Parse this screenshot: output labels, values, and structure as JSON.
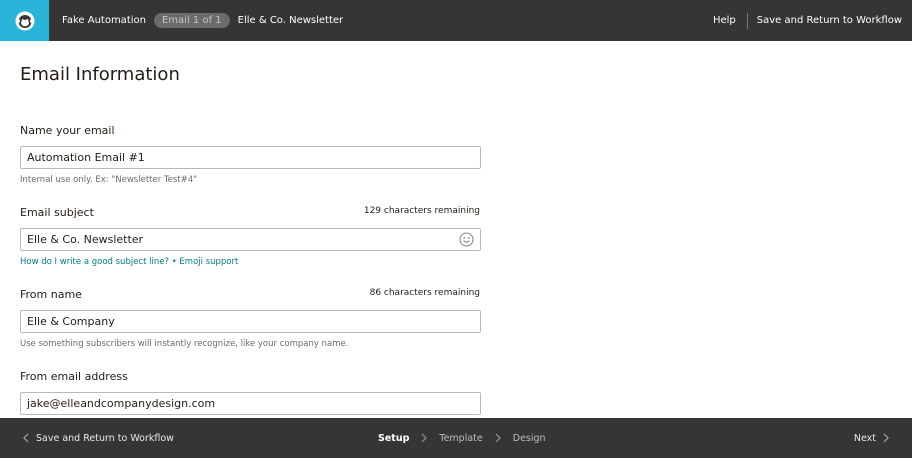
{
  "header": {
    "breadcrumb": {
      "automation": "Fake Automation",
      "email_badge": "Email 1 of 1",
      "email_name": "Elle & Co. Newsletter"
    },
    "help": "Help",
    "save_return": "Save and Return to Workflow"
  },
  "main": {
    "title": "Email Information",
    "name": {
      "label": "Name your email",
      "value": "Automation Email #1",
      "hint": "Internal use only. Ex: \"Newsletter Test#4\""
    },
    "subject": {
      "label": "Email subject",
      "remaining": "129 characters remaining",
      "value": "Elle & Co. Newsletter",
      "help_link": "How do I write a good subject line?",
      "separator": " • ",
      "emoji_link": "Emoji support"
    },
    "from_name": {
      "label": "From name",
      "remaining": "86 characters remaining",
      "value": "Elle & Company",
      "hint": "Use something subscribers will instantly recognize, like your company name."
    },
    "from_email": {
      "label": "From email address",
      "value": "jake@elleandcompanydesign.com"
    }
  },
  "footer": {
    "back": "Save and Return to Workflow",
    "steps": [
      "Setup",
      "Template",
      "Design"
    ],
    "active_step": 0,
    "next": "Next"
  },
  "colors": {
    "header_bg": "#353535",
    "logo_bg": "#2ab4d9",
    "link": "#007c89"
  }
}
